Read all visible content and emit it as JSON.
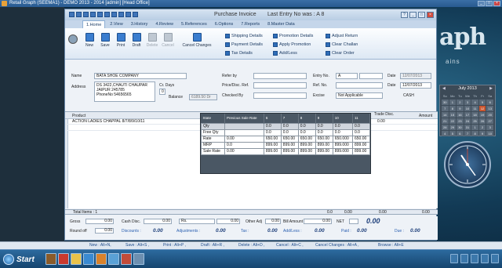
{
  "window": {
    "title": "Retail Graph (SEEMA1)  - DEMO  2013 - 2014 [admin] [Head Office]"
  },
  "invoice": {
    "title": "Purchase Invoice",
    "last_entry": "Last Entry No was : A 8"
  },
  "tabs": [
    "1.Home",
    "2.View",
    "3.History",
    "4.Review",
    "5.References",
    "6.Options",
    "7.Reports",
    "8.Master Data"
  ],
  "ribbon": {
    "buttons": [
      "New",
      "Save",
      "Print",
      "Draft",
      "Delete",
      "Cancel",
      "Cancel Changes"
    ],
    "links_col1": [
      "Shipping Details",
      "Payment Details",
      "Tax Details"
    ],
    "links_col2": [
      "Promotion Details",
      "Apply Promotion",
      "Add/Less"
    ],
    "links_col3": [
      "Adjust Return",
      "Clear Challan",
      "Clear Order"
    ]
  },
  "header": {
    "name_label": "Name",
    "name_value": "BATA SHOE COMPANY",
    "address_label": "Address",
    "address_lines": [
      "DS 3422,CHAUTI CHAUPAR",
      "JAIPUR 245785",
      "PhoneNo 54656565"
    ],
    "cr_days_label": "Cr. Days",
    "cr_days_value": "0",
    "balance_label": "Balance",
    "balance_value": "6189.50 Dr",
    "refer_by_label": "Refer by",
    "price_desc_label": "Price/Disc. Ref.",
    "checked_by_label": "Checked By",
    "entry_no_label": "Entry No.",
    "entry_no_value": "A",
    "ref_no_label": "Ref. No.",
    "excise_label": "Excise",
    "excise_value": "Not Applicable",
    "date_label": "Date",
    "date_value": "12/07/2013",
    "date2_label": "Date",
    "date2_value": "12/07/2013",
    "cash_label": "CASH"
  },
  "grid": {
    "columns": [
      "Product",
      "Trade Disc.",
      "Amount"
    ],
    "row": {
      "product": "ACTION LADIES CHAPPAL 8/7/8/9/10/11",
      "trade_disc": "0.00"
    },
    "total_items_label": "Total Items : 1",
    "totals": [
      "0.0",
      "0.00",
      "0.00",
      "0.00"
    ]
  },
  "popup": {
    "header": [
      "State",
      "Previous Sale Rate",
      "6",
      "7",
      "8",
      "9",
      "10",
      "11"
    ],
    "rows": [
      {
        "label": "Qty",
        "values": [
          "",
          "0.0",
          "0.0",
          "0.0",
          "0.0",
          "0.0",
          "0.0"
        ]
      },
      {
        "label": "Free Qty",
        "values": [
          "",
          "0.0",
          "0.0",
          "0.0",
          "0.0",
          "0.0",
          "0.0"
        ]
      },
      {
        "label": "Rate",
        "values": [
          "0.00",
          "650.00",
          "650.00",
          "650.00",
          "650.00",
          "650.000",
          "650.00"
        ]
      },
      {
        "label": "MRP",
        "values": [
          "0.0",
          "899.00",
          "899.00",
          "899.00",
          "899.00",
          "899.000",
          "899.00"
        ]
      },
      {
        "label": "Sale Rate",
        "values": [
          "0.00",
          "899.00",
          "899.00",
          "899.00",
          "899.00",
          "899.000",
          "899.00"
        ]
      }
    ]
  },
  "footer": {
    "gross_label": "Gross",
    "gross_value": "0.00",
    "cash_disc_label": "Cash Disc.",
    "cash_disc_value": "0.00",
    "rs_label": "Rs.",
    "rs_value": "0.00",
    "other_adj_label": "Other Adj",
    "other_adj_value": "0.00",
    "bill_amount_label": "Bill Amount",
    "bill_amount_value": "0.00",
    "net_label": "NET",
    "net_value": "0.00",
    "round_off_label": "Round off",
    "round_off_value": "0.00",
    "discounts_label": "Discounts :",
    "discounts_value": "0.00",
    "adjustments_label": "Adjustments :",
    "adjustments_value": "0.00",
    "tax_label": "Tax :",
    "tax_value": "0.00",
    "addless_label": "Add/Less :",
    "addless_value": "0.00",
    "paid_label": "Paid :",
    "paid_value": "0.00",
    "due_label": "Due :",
    "due_value": "0.00"
  },
  "shortcuts": [
    "New : Alt+N,",
    "Save : Alt+S ,",
    "Print : Alt+P ,",
    "Draft : Alt+R ,",
    "Delete : Alt+D ,",
    "Cancel : Alt+C ,",
    "Cancel Changes : Alt+A ,",
    "Browse : Alt+E"
  ],
  "calendar": {
    "month": "July 2013",
    "weekdays": [
      "Su",
      "Mo",
      "Tu",
      "We",
      "Th",
      "Fr",
      "Sa"
    ],
    "days": [
      "30",
      "1",
      "2",
      "3",
      "4",
      "5",
      "6",
      "7",
      "8",
      "9",
      "10",
      "11",
      "12",
      "13",
      "14",
      "15",
      "16",
      "17",
      "18",
      "19",
      "20",
      "21",
      "22",
      "23",
      "24",
      "25",
      "26",
      "27",
      "28",
      "29",
      "30",
      "31",
      "1",
      "2",
      "3",
      "4",
      "5",
      "6",
      "7",
      "8",
      "9",
      "10"
    ],
    "today": "12"
  },
  "brand": {
    "text": "aph",
    "sub": "ains"
  },
  "taskbar": {
    "start_label": "Start"
  },
  "colors": {
    "accent": "#2a5fb0",
    "popup_bg": "#4a5764",
    "titlebar": "#3a6ea5"
  }
}
